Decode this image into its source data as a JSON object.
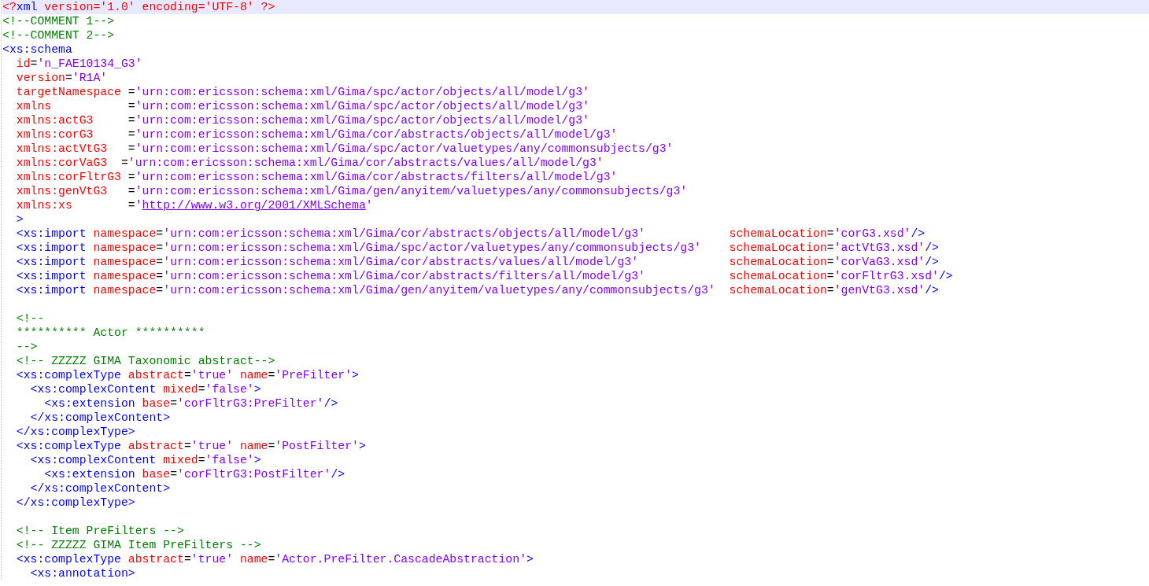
{
  "editor": {
    "lines": [
      {
        "current": true,
        "tokens": [
          {
            "kind": "pi",
            "text": "<?"
          },
          {
            "kind": "tag",
            "text": "xml"
          },
          {
            "kind": "pi",
            "text": " version='1.0' encoding='UTF-8' ?>"
          }
        ]
      },
      {
        "current": false,
        "tokens": [
          {
            "kind": "comment",
            "text": "<!--COMMENT 1-->"
          }
        ]
      },
      {
        "current": false,
        "tokens": [
          {
            "kind": "comment",
            "text": "<!--COMMENT 2-->"
          }
        ]
      },
      {
        "current": false,
        "tokens": [
          {
            "kind": "tag",
            "text": "<xs:schema"
          }
        ]
      },
      {
        "current": false,
        "tokens": [
          {
            "kind": "attr",
            "text": "  id"
          },
          {
            "kind": "eq",
            "text": "="
          },
          {
            "kind": "value",
            "text": "'n_FAE10134_G3'"
          }
        ]
      },
      {
        "current": false,
        "tokens": [
          {
            "kind": "attr",
            "text": "  version"
          },
          {
            "kind": "eq",
            "text": "="
          },
          {
            "kind": "value",
            "text": "'R1A'"
          }
        ]
      },
      {
        "current": false,
        "tokens": [
          {
            "kind": "attr",
            "text": "  targetNamespace"
          },
          {
            "kind": "eq",
            "text": " ="
          },
          {
            "kind": "value",
            "text": "'urn:com:ericsson:schema:xml/Gima/spc/actor/objects/all/model/g3'"
          }
        ]
      },
      {
        "current": false,
        "tokens": [
          {
            "kind": "attr",
            "text": "  xmlns"
          },
          {
            "kind": "eq",
            "text": "           ="
          },
          {
            "kind": "value",
            "text": "'urn:com:ericsson:schema:xml/Gima/spc/actor/objects/all/model/g3'"
          }
        ]
      },
      {
        "current": false,
        "tokens": [
          {
            "kind": "attr",
            "text": "  xmlns:actG3"
          },
          {
            "kind": "eq",
            "text": "     ="
          },
          {
            "kind": "value",
            "text": "'urn:com:ericsson:schema:xml/Gima/spc/actor/objects/all/model/g3'"
          }
        ]
      },
      {
        "current": false,
        "tokens": [
          {
            "kind": "attr",
            "text": "  xmlns:corG3"
          },
          {
            "kind": "eq",
            "text": "     ="
          },
          {
            "kind": "value",
            "text": "'urn:com:ericsson:schema:xml/Gima/cor/abstracts/objects/all/model/g3'"
          }
        ]
      },
      {
        "current": false,
        "tokens": [
          {
            "kind": "attr",
            "text": "  xmlns:actVtG3"
          },
          {
            "kind": "eq",
            "text": "   ="
          },
          {
            "kind": "value",
            "text": "'urn:com:ericsson:schema:xml/Gima/spc/actor/valuetypes/any/commonsubjects/g3'"
          }
        ]
      },
      {
        "current": false,
        "tokens": [
          {
            "kind": "attr",
            "text": "  xmlns:corVaG3"
          },
          {
            "kind": "eq",
            "text": "  ="
          },
          {
            "kind": "value",
            "text": "'urn:com:ericsson:schema:xml/Gima/cor/abstracts/values/all/model/g3'"
          }
        ]
      },
      {
        "current": false,
        "tokens": [
          {
            "kind": "attr",
            "text": "  xmlns:corFltrG3"
          },
          {
            "kind": "eq",
            "text": " ="
          },
          {
            "kind": "value",
            "text": "'urn:com:ericsson:schema:xml/Gima/cor/abstracts/filters/all/model/g3'"
          }
        ]
      },
      {
        "current": false,
        "tokens": [
          {
            "kind": "attr",
            "text": "  xmlns:genVtG3"
          },
          {
            "kind": "eq",
            "text": "   ="
          },
          {
            "kind": "value",
            "text": "'urn:com:ericsson:schema:xml/Gima/gen/anyitem/valuetypes/any/commonsubjects/g3'"
          }
        ]
      },
      {
        "current": false,
        "tokens": [
          {
            "kind": "attr",
            "text": "  xmlns:xs"
          },
          {
            "kind": "eq",
            "text": "        ="
          },
          {
            "kind": "value",
            "text": "'"
          },
          {
            "kind": "link",
            "text": "http://www.w3.org/2001/XMLSchema"
          },
          {
            "kind": "value",
            "text": "'"
          }
        ]
      },
      {
        "current": false,
        "tokens": [
          {
            "kind": "tag",
            "text": "  >"
          }
        ]
      },
      {
        "current": false,
        "tokens": [
          {
            "kind": "tag",
            "text": "  <xs:import"
          },
          {
            "kind": "attr",
            "text": " namespace"
          },
          {
            "kind": "eq",
            "text": "="
          },
          {
            "kind": "value",
            "text": "'urn:com:ericsson:schema:xml/Gima/cor/abstracts/objects/all/model/g3'"
          },
          {
            "kind": "attr",
            "text": "            schemaLocation"
          },
          {
            "kind": "eq",
            "text": "="
          },
          {
            "kind": "value",
            "text": "'corG3.xsd'"
          },
          {
            "kind": "tag",
            "text": "/>"
          }
        ]
      },
      {
        "current": false,
        "tokens": [
          {
            "kind": "tag",
            "text": "  <xs:import"
          },
          {
            "kind": "attr",
            "text": " namespace"
          },
          {
            "kind": "eq",
            "text": "="
          },
          {
            "kind": "value",
            "text": "'urn:com:ericsson:schema:xml/Gima/spc/actor/valuetypes/any/commonsubjects/g3'"
          },
          {
            "kind": "attr",
            "text": "    schemaLocation"
          },
          {
            "kind": "eq",
            "text": "="
          },
          {
            "kind": "value",
            "text": "'actVtG3.xsd'"
          },
          {
            "kind": "tag",
            "text": "/>"
          }
        ]
      },
      {
        "current": false,
        "tokens": [
          {
            "kind": "tag",
            "text": "  <xs:import"
          },
          {
            "kind": "attr",
            "text": " namespace"
          },
          {
            "kind": "eq",
            "text": "="
          },
          {
            "kind": "value",
            "text": "'urn:com:ericsson:schema:xml/Gima/cor/abstracts/values/all/model/g3'"
          },
          {
            "kind": "attr",
            "text": "             schemaLocation"
          },
          {
            "kind": "eq",
            "text": "="
          },
          {
            "kind": "value",
            "text": "'corVaG3.xsd'"
          },
          {
            "kind": "tag",
            "text": "/>"
          }
        ]
      },
      {
        "current": false,
        "tokens": [
          {
            "kind": "tag",
            "text": "  <xs:import"
          },
          {
            "kind": "attr",
            "text": " namespace"
          },
          {
            "kind": "eq",
            "text": "="
          },
          {
            "kind": "value",
            "text": "'urn:com:ericsson:schema:xml/Gima/cor/abstracts/filters/all/model/g3'"
          },
          {
            "kind": "attr",
            "text": "            schemaLocation"
          },
          {
            "kind": "eq",
            "text": "="
          },
          {
            "kind": "value",
            "text": "'corFltrG3.xsd'"
          },
          {
            "kind": "tag",
            "text": "/>"
          }
        ]
      },
      {
        "current": false,
        "tokens": [
          {
            "kind": "tag",
            "text": "  <xs:import"
          },
          {
            "kind": "attr",
            "text": " namespace"
          },
          {
            "kind": "eq",
            "text": "="
          },
          {
            "kind": "value",
            "text": "'urn:com:ericsson:schema:xml/Gima/gen/anyitem/valuetypes/any/commonsubjects/g3'"
          },
          {
            "kind": "attr",
            "text": "  schemaLocation"
          },
          {
            "kind": "eq",
            "text": "="
          },
          {
            "kind": "value",
            "text": "'genVtG3.xsd'"
          },
          {
            "kind": "tag",
            "text": "/>"
          }
        ]
      },
      {
        "kind": "blank"
      },
      {
        "current": false,
        "tokens": [
          {
            "kind": "comment",
            "text": "  <!--"
          }
        ]
      },
      {
        "current": false,
        "tokens": [
          {
            "kind": "comment",
            "text": "  ********** Actor **********"
          }
        ]
      },
      {
        "current": false,
        "tokens": [
          {
            "kind": "comment",
            "text": "  -->"
          }
        ]
      },
      {
        "current": false,
        "tokens": [
          {
            "kind": "comment",
            "text": "  <!-- ZZZZZ GIMA Taxonomic abstract-->"
          }
        ]
      },
      {
        "current": false,
        "tokens": [
          {
            "kind": "tag",
            "text": "  <xs:complexType"
          },
          {
            "kind": "attr",
            "text": " abstract"
          },
          {
            "kind": "eq",
            "text": "="
          },
          {
            "kind": "value",
            "text": "'true'"
          },
          {
            "kind": "attr",
            "text": " name"
          },
          {
            "kind": "eq",
            "text": "="
          },
          {
            "kind": "value",
            "text": "'PreFilter'"
          },
          {
            "kind": "tag",
            "text": ">"
          }
        ]
      },
      {
        "current": false,
        "tokens": [
          {
            "kind": "tag",
            "text": "    <xs:complexContent"
          },
          {
            "kind": "attr",
            "text": " mixed"
          },
          {
            "kind": "eq",
            "text": "="
          },
          {
            "kind": "value",
            "text": "'false'"
          },
          {
            "kind": "tag",
            "text": ">"
          }
        ]
      },
      {
        "current": false,
        "tokens": [
          {
            "kind": "tag",
            "text": "      <xs:extension"
          },
          {
            "kind": "attr",
            "text": " base"
          },
          {
            "kind": "eq",
            "text": "="
          },
          {
            "kind": "value",
            "text": "'corFltrG3:PreFilter'"
          },
          {
            "kind": "tag",
            "text": "/>"
          }
        ]
      },
      {
        "current": false,
        "tokens": [
          {
            "kind": "tag",
            "text": "    </xs:complexContent>"
          }
        ]
      },
      {
        "current": false,
        "tokens": [
          {
            "kind": "tag",
            "text": "  </xs:complexType>"
          }
        ]
      },
      {
        "current": false,
        "tokens": [
          {
            "kind": "tag",
            "text": "  <xs:complexType"
          },
          {
            "kind": "attr",
            "text": " abstract"
          },
          {
            "kind": "eq",
            "text": "="
          },
          {
            "kind": "value",
            "text": "'true'"
          },
          {
            "kind": "attr",
            "text": " name"
          },
          {
            "kind": "eq",
            "text": "="
          },
          {
            "kind": "value",
            "text": "'PostFilter'"
          },
          {
            "kind": "tag",
            "text": ">"
          }
        ]
      },
      {
        "current": false,
        "tokens": [
          {
            "kind": "tag",
            "text": "    <xs:complexContent"
          },
          {
            "kind": "attr",
            "text": " mixed"
          },
          {
            "kind": "eq",
            "text": "="
          },
          {
            "kind": "value",
            "text": "'false'"
          },
          {
            "kind": "tag",
            "text": ">"
          }
        ]
      },
      {
        "current": false,
        "tokens": [
          {
            "kind": "tag",
            "text": "      <xs:extension"
          },
          {
            "kind": "attr",
            "text": " base"
          },
          {
            "kind": "eq",
            "text": "="
          },
          {
            "kind": "value",
            "text": "'corFltrG3:PostFilter'"
          },
          {
            "kind": "tag",
            "text": "/>"
          }
        ]
      },
      {
        "current": false,
        "tokens": [
          {
            "kind": "tag",
            "text": "    </xs:complexContent>"
          }
        ]
      },
      {
        "current": false,
        "tokens": [
          {
            "kind": "tag",
            "text": "  </xs:complexType>"
          }
        ]
      },
      {
        "kind": "blank"
      },
      {
        "current": false,
        "tokens": [
          {
            "kind": "comment",
            "text": "  <!-- Item PreFilters -->"
          }
        ]
      },
      {
        "current": false,
        "tokens": [
          {
            "kind": "comment",
            "text": "  <!-- ZZZZZ GIMA Item PreFilters -->"
          }
        ]
      },
      {
        "current": false,
        "tokens": [
          {
            "kind": "tag",
            "text": "  <xs:complexType"
          },
          {
            "kind": "attr",
            "text": " abstract"
          },
          {
            "kind": "eq",
            "text": "="
          },
          {
            "kind": "value",
            "text": "'true'"
          },
          {
            "kind": "attr",
            "text": " name"
          },
          {
            "kind": "eq",
            "text": "="
          },
          {
            "kind": "value",
            "text": "'Actor.PreFilter.CascadeAbstraction'"
          },
          {
            "kind": "tag",
            "text": ">"
          }
        ]
      },
      {
        "current": false,
        "tokens": [
          {
            "kind": "tag",
            "text": "    <xs:annotation>"
          }
        ]
      }
    ]
  }
}
